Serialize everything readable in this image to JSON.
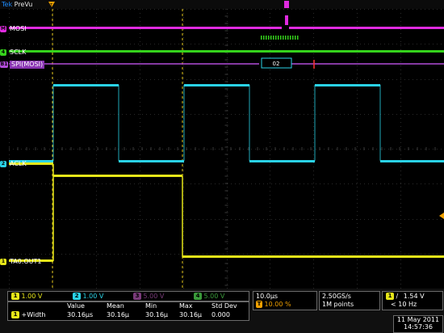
{
  "app": {
    "brand_a": "Tek",
    "brand_b": " PreVu"
  },
  "channels": {
    "mosi": {
      "num": "M",
      "label": "MOSI",
      "color": "#e02be0"
    },
    "sclk": {
      "num": "4",
      "label": "SCLK",
      "color": "#35d21c"
    },
    "spi": {
      "num": "B1",
      "label": "SPI(MOSI)",
      "color": "#b14cd8",
      "value": "02"
    },
    "aclk": {
      "num": "2",
      "label": "ACLK",
      "color": "#2ad2e6"
    },
    "ta0": {
      "num": "1",
      "label": "TA0.OUT1",
      "color": "#e6e619"
    }
  },
  "readout": {
    "ch1": {
      "num": "1",
      "value": "1.00 V",
      "color": "#e6e619"
    },
    "ch2": {
      "num": "2",
      "value": "1.00 V",
      "color": "#2ad2e6"
    },
    "ch3": {
      "num": "3",
      "value": "5.00 V",
      "color": "#b14cd8"
    },
    "ch4": {
      "num": "4",
      "value": "5.00 V",
      "color": "#35d21c"
    },
    "timebase": {
      "div": "10.0µs",
      "pos_marker": "T",
      "pos": "10.00 %"
    },
    "acq": {
      "rate": "2.50GS/s",
      "points": "1M points"
    },
    "trigger": {
      "ch": "1",
      "slope": "/",
      "level": "1.54 V",
      "freq": "< 10 Hz"
    },
    "measure": {
      "headers": [
        "Value",
        "Mean",
        "Min",
        "Max",
        "Std Dev"
      ],
      "ch": "1",
      "name": "+Width",
      "values": [
        "30.16µs",
        "30.16µ",
        "30.16µ",
        "30.16µ",
        "0.000"
      ]
    },
    "date": "11 May 2011",
    "time": "14:57:36"
  }
}
